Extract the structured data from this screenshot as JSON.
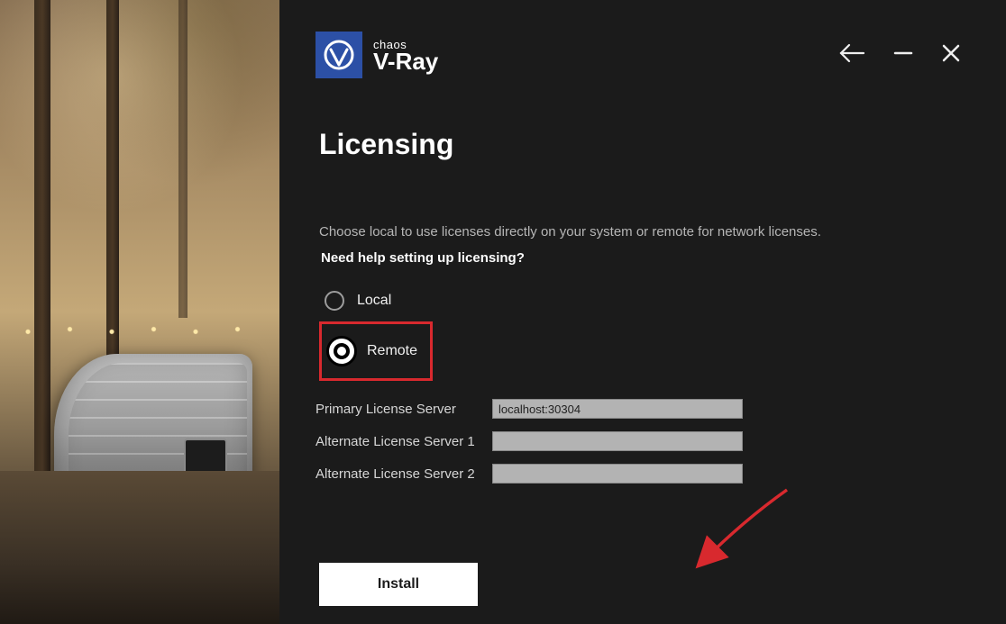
{
  "brand": {
    "company": "chaos",
    "product": "V-Ray"
  },
  "page": {
    "title": "Licensing",
    "description": "Choose local to use licenses directly on your system or remote for network licenses.",
    "help_link": "Need help setting up licensing?"
  },
  "options": {
    "local_label": "Local",
    "remote_label": "Remote",
    "selected": "remote"
  },
  "servers": {
    "primary_label": "Primary License Server",
    "primary_value": "localhost:30304",
    "alt1_label": "Alternate License Server 1",
    "alt1_value": "",
    "alt2_label": "Alternate License Server 2",
    "alt2_value": ""
  },
  "actions": {
    "install_label": "Install"
  },
  "annotation": {
    "highlight_target": "remote-option",
    "arrow_color": "#d8292e"
  }
}
